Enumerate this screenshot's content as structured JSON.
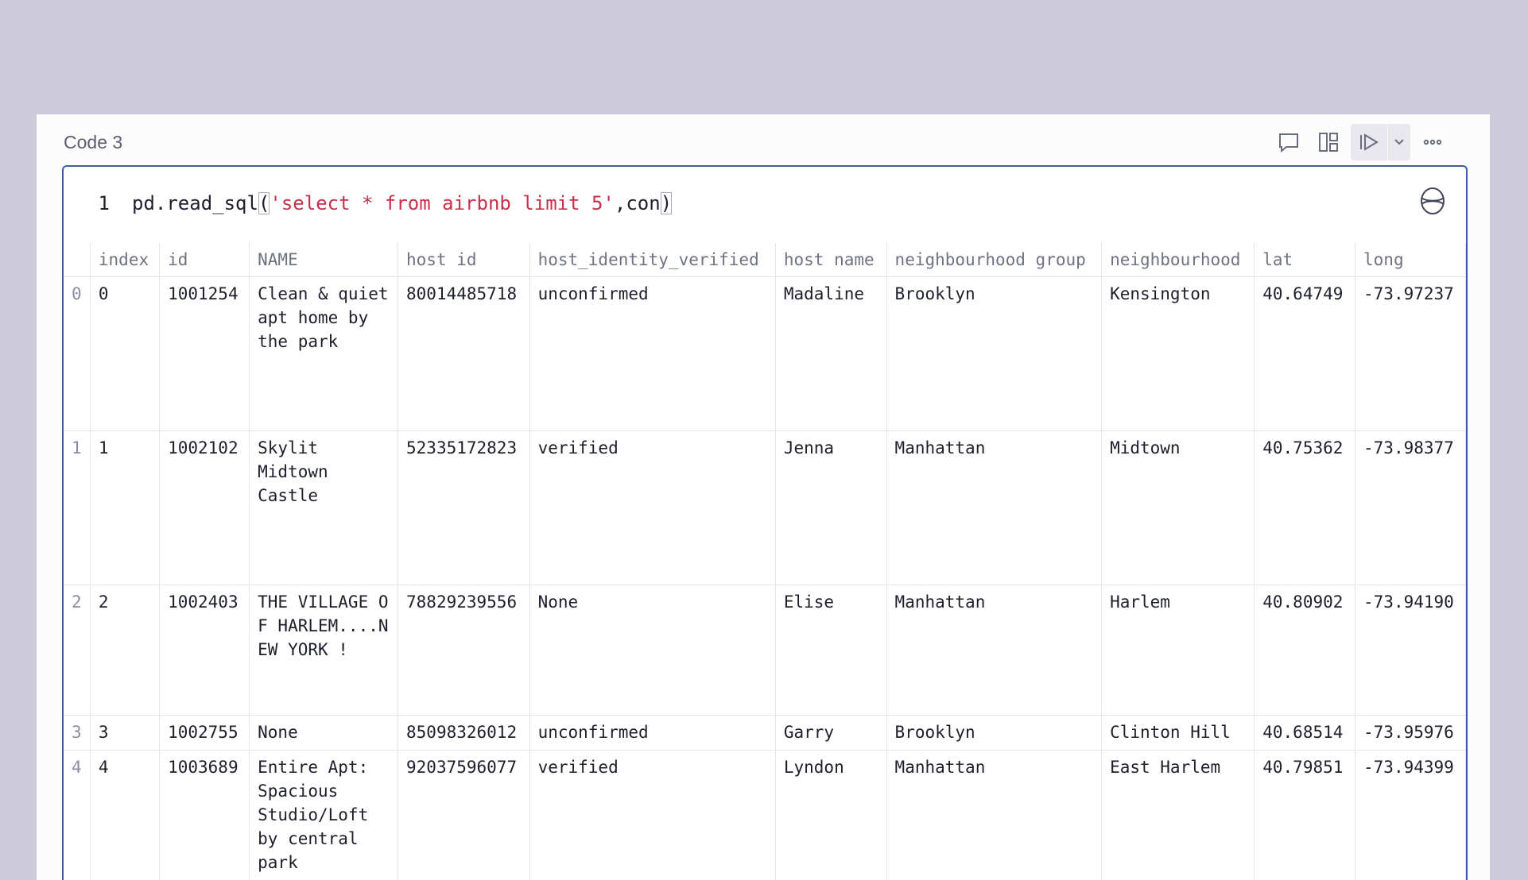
{
  "cell": {
    "title": "Code 3",
    "toolbar": {
      "comment_icon": "comment-icon",
      "layout_icon": "layout-icon",
      "run_icon": "run-icon",
      "more_icon": "more-icon"
    },
    "code": {
      "line_number": "1",
      "prefix": "pd.read_sql",
      "open_paren": "(",
      "string": "'select * from airbnb limit 5'",
      "suffix": ",con",
      "close_paren": ")"
    },
    "table": {
      "columns": [
        "",
        "index",
        "id",
        "NAME",
        "host id",
        "host_identity_verified",
        "host name",
        "neighbourhood group",
        "neighbourhood",
        "lat",
        "long"
      ],
      "rows": [
        [
          "0",
          "0",
          "1001254",
          "Clean & quiet apt home by the park",
          "80014485718",
          "unconfirmed",
          "Madaline",
          "Brooklyn",
          "Kensington",
          "40.64749",
          "-73.97237"
        ],
        [
          "1",
          "1",
          "1002102",
          "Skylit Midtown Castle",
          "52335172823",
          "verified",
          "Jenna",
          "Manhattan",
          "Midtown",
          "40.75362",
          "-73.98377"
        ],
        [
          "2",
          "2",
          "1002403",
          "THE VILLAGE OF HARLEM....NEW YORK !",
          "78829239556",
          "None",
          "Elise",
          "Manhattan",
          "Harlem",
          "40.80902",
          "-73.94190"
        ],
        [
          "3",
          "3",
          "1002755",
          "None",
          "85098326012",
          "unconfirmed",
          "Garry",
          "Brooklyn",
          "Clinton Hill",
          "40.68514",
          "-73.95976"
        ],
        [
          "4",
          "4",
          "1003689",
          "Entire Apt: Spacious Studio/Loft by central park",
          "92037596077",
          "verified",
          "Lyndon",
          "Manhattan",
          "East Harlem",
          "40.79851",
          "-73.94399"
        ]
      ]
    }
  }
}
